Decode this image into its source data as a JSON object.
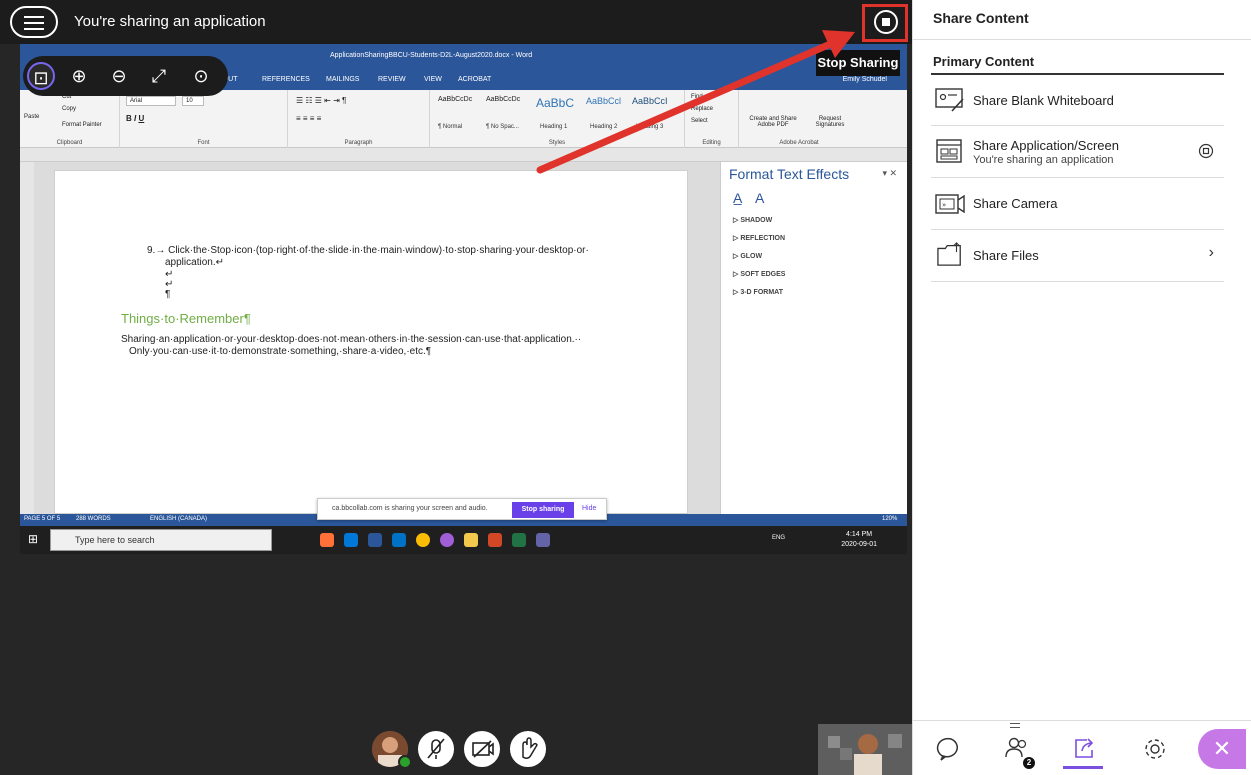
{
  "topbar": {
    "title": "You're sharing an application",
    "stop_tooltip": "Stop Sharing"
  },
  "word": {
    "title": "ApplicationSharingBBCU-Students-D2L-August2020.docx - Word",
    "user": "Emily Schudel",
    "tabs": [
      "LAYOUT",
      "REFERENCES",
      "MAILINGS",
      "REVIEW",
      "VIEW",
      "ACROBAT"
    ],
    "clipboard": {
      "cut": "Cut",
      "copy": "Copy",
      "paste": "Paste",
      "format_painter": "Format Painter",
      "label": "Clipboard"
    },
    "font": {
      "name": "Arial",
      "size": "10",
      "label": "Font"
    },
    "paragraph_label": "Paragraph",
    "styles": {
      "label": "Styles",
      "items": [
        {
          "preview": "AaBbCcDc",
          "name": "¶ Normal"
        },
        {
          "preview": "AaBbCcDc",
          "name": "¶ No Spac..."
        },
        {
          "preview": "AaBbC",
          "name": "Heading 1"
        },
        {
          "preview": "AaBbCcl",
          "name": "Heading 2"
        },
        {
          "preview": "AaBbCcI",
          "name": "Heading 3"
        }
      ]
    },
    "editing": {
      "find": "Find",
      "replace": "Replace",
      "select": "Select",
      "label": "Editing"
    },
    "acrobat": {
      "create_share": "Create and Share Adobe PDF",
      "request_sig": "Request Signatures",
      "label": "Adobe Acrobat"
    },
    "doc": {
      "step9_line1": "9.→ Click·the·Stop·icon·(top·right·of·the·slide·in·the·main·window)·to·stop·sharing·your·desktop·or·",
      "step9_line2": "application.↵",
      "mark1": "↵",
      "mark2": "↵",
      "mark3": "¶",
      "heading": "Things·to·Remember¶",
      "bullet_line1": "Sharing·an·application·or·your·desktop·does·not·mean·others·in·the·session·can·use·that·application.··",
      "bullet_line2": "Only·you·can·use·it·to·demonstrate·something,·share·a·video,·etc.¶"
    },
    "pane": {
      "title": "Format Text Effects",
      "items": [
        "SHADOW",
        "REFLECTION",
        "GLOW",
        "SOFT EDGES",
        "3-D FORMAT"
      ]
    },
    "status": {
      "page": "PAGE 5 OF 5",
      "words": "288 WORDS",
      "lang": "ENGLISH (CANADA)",
      "zoom": "120%"
    }
  },
  "taskbar": {
    "search_placeholder": "Type here to search",
    "lang": "ENG",
    "time": "4:14 PM",
    "date": "2020-09-01"
  },
  "share_notification": {
    "text": "ca.bbcollab.com is sharing your screen and audio.",
    "stop_label": "Stop sharing",
    "hide_label": "Hide"
  },
  "panel": {
    "title": "Share Content",
    "section": "Primary Content",
    "items": [
      {
        "label": "Share Blank Whiteboard",
        "sub": ""
      },
      {
        "label": "Share Application/Screen",
        "sub": "You're sharing an application"
      },
      {
        "label": "Share Camera",
        "sub": ""
      },
      {
        "label": "Share Files",
        "sub": ""
      }
    ],
    "attendee_count": "2"
  },
  "colors": {
    "accent": "#7b4fe0",
    "highlight_red": "#e0332b",
    "word_blue": "#2b579a",
    "heading_green": "#70ad47"
  }
}
